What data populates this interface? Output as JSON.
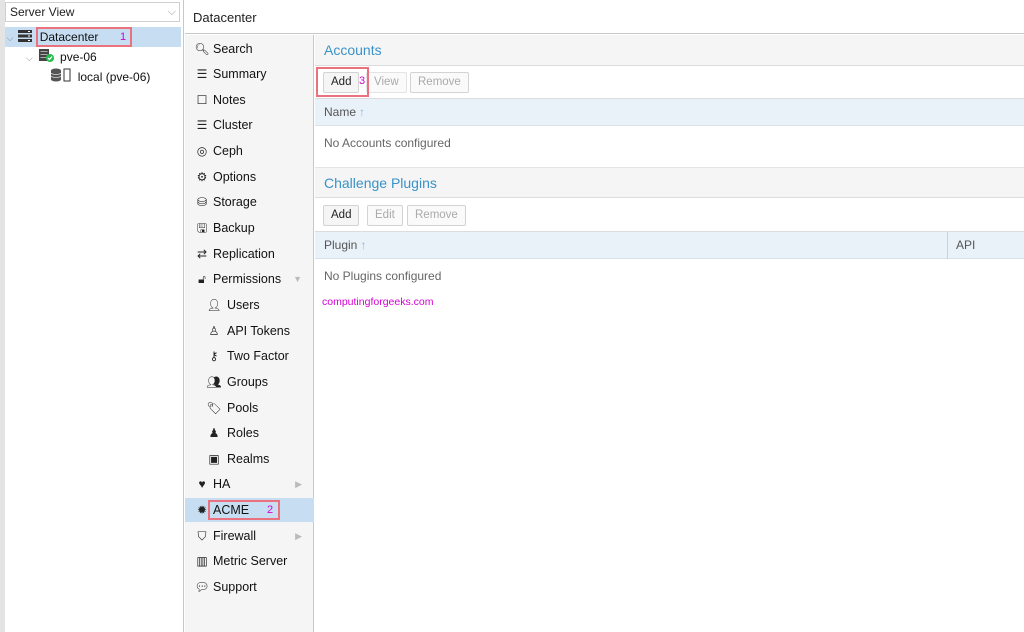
{
  "tree": {
    "view_select": "Server View",
    "datacenter": "Datacenter",
    "node": "pve-06",
    "storage": "local (pve-06)"
  },
  "annotations": {
    "n1": "1",
    "n2": "2",
    "n3": "3"
  },
  "header": {
    "title": "Datacenter"
  },
  "nav": {
    "search": "Search",
    "summary": "Summary",
    "notes": "Notes",
    "cluster": "Cluster",
    "ceph": "Ceph",
    "options": "Options",
    "storage": "Storage",
    "backup": "Backup",
    "replication": "Replication",
    "permissions": "Permissions",
    "users": "Users",
    "api_tokens": "API Tokens",
    "two_factor": "Two Factor",
    "groups": "Groups",
    "pools": "Pools",
    "roles": "Roles",
    "realms": "Realms",
    "ha": "HA",
    "acme": "ACME",
    "firewall": "Firewall",
    "metric_server": "Metric Server",
    "support": "Support"
  },
  "accounts": {
    "title": "Accounts",
    "add": "Add",
    "view": "View",
    "remove": "Remove",
    "col_name": "Name",
    "empty": "No Accounts configured"
  },
  "plugins": {
    "title": "Challenge Plugins",
    "add": "Add",
    "edit": "Edit",
    "remove": "Remove",
    "col_plugin": "Plugin",
    "col_api": "API",
    "empty": "No Plugins configured"
  },
  "watermark": "computingforgeeks.com",
  "colors": {
    "accent": "#3a92c7",
    "selection": "#c7ddf2",
    "annotation": "#e9727e",
    "watermark": "#d400d4"
  }
}
